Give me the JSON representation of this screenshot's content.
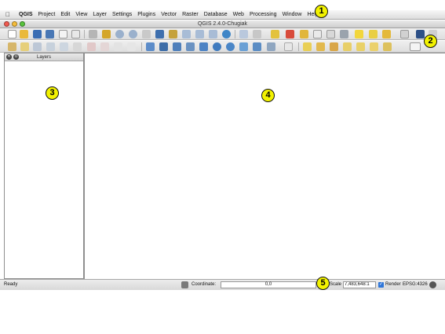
{
  "menubar": {
    "apple_icon": "apple-icon",
    "items": [
      "QGIS",
      "Project",
      "Edit",
      "View",
      "Layer",
      "Settings",
      "Plugins",
      "Vector",
      "Raster",
      "Database",
      "Web",
      "Processing",
      "Window",
      "Help"
    ]
  },
  "window": {
    "title": "QGIS 2.4.0-Chugiak"
  },
  "layers_panel": {
    "title": "Layers",
    "close_glyph": "✕",
    "float_glyph": "⊙"
  },
  "statusbar": {
    "status": "Ready",
    "coordinate_label": "Coordinate:",
    "coordinate_value": "0,0",
    "scale_label": "Scale",
    "scale_value": "7,483,648:1",
    "render_label": "Render",
    "render_checked": true,
    "crs": "EPSG:4326"
  },
  "callouts": [
    "1",
    "2",
    "3",
    "4",
    "5"
  ],
  "colors": {
    "callout": "#f2f200",
    "canvas": "#ffffff"
  }
}
